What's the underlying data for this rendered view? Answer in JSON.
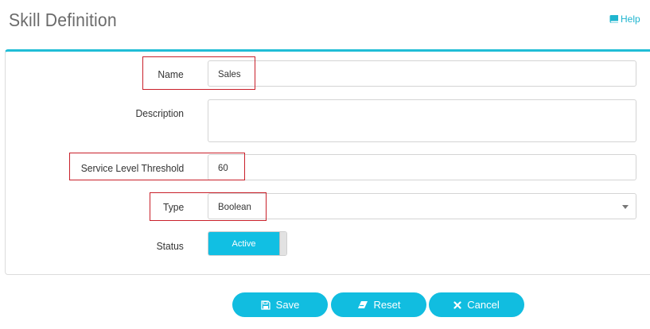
{
  "header": {
    "title": "Skill Definition",
    "help_label": "Help"
  },
  "form": {
    "name": {
      "label": "Name",
      "value": "Sales"
    },
    "description": {
      "label": "Description",
      "value": ""
    },
    "threshold": {
      "label": "Service Level Threshold",
      "value": "60"
    },
    "type": {
      "label": "Type",
      "value": "Boolean"
    },
    "status": {
      "label": "Status",
      "toggle_label": "Active",
      "on": true
    }
  },
  "actions": {
    "save": "Save",
    "reset": "Reset",
    "cancel": "Cancel"
  },
  "colors": {
    "accent": "#11bde0",
    "highlight": "#c9202a",
    "title": "#6b6b6b"
  },
  "icons": {
    "help": "book-icon",
    "save": "floppy-disk-icon",
    "reset": "eraser-icon",
    "cancel": "close-icon",
    "select": "caret-down-icon"
  }
}
